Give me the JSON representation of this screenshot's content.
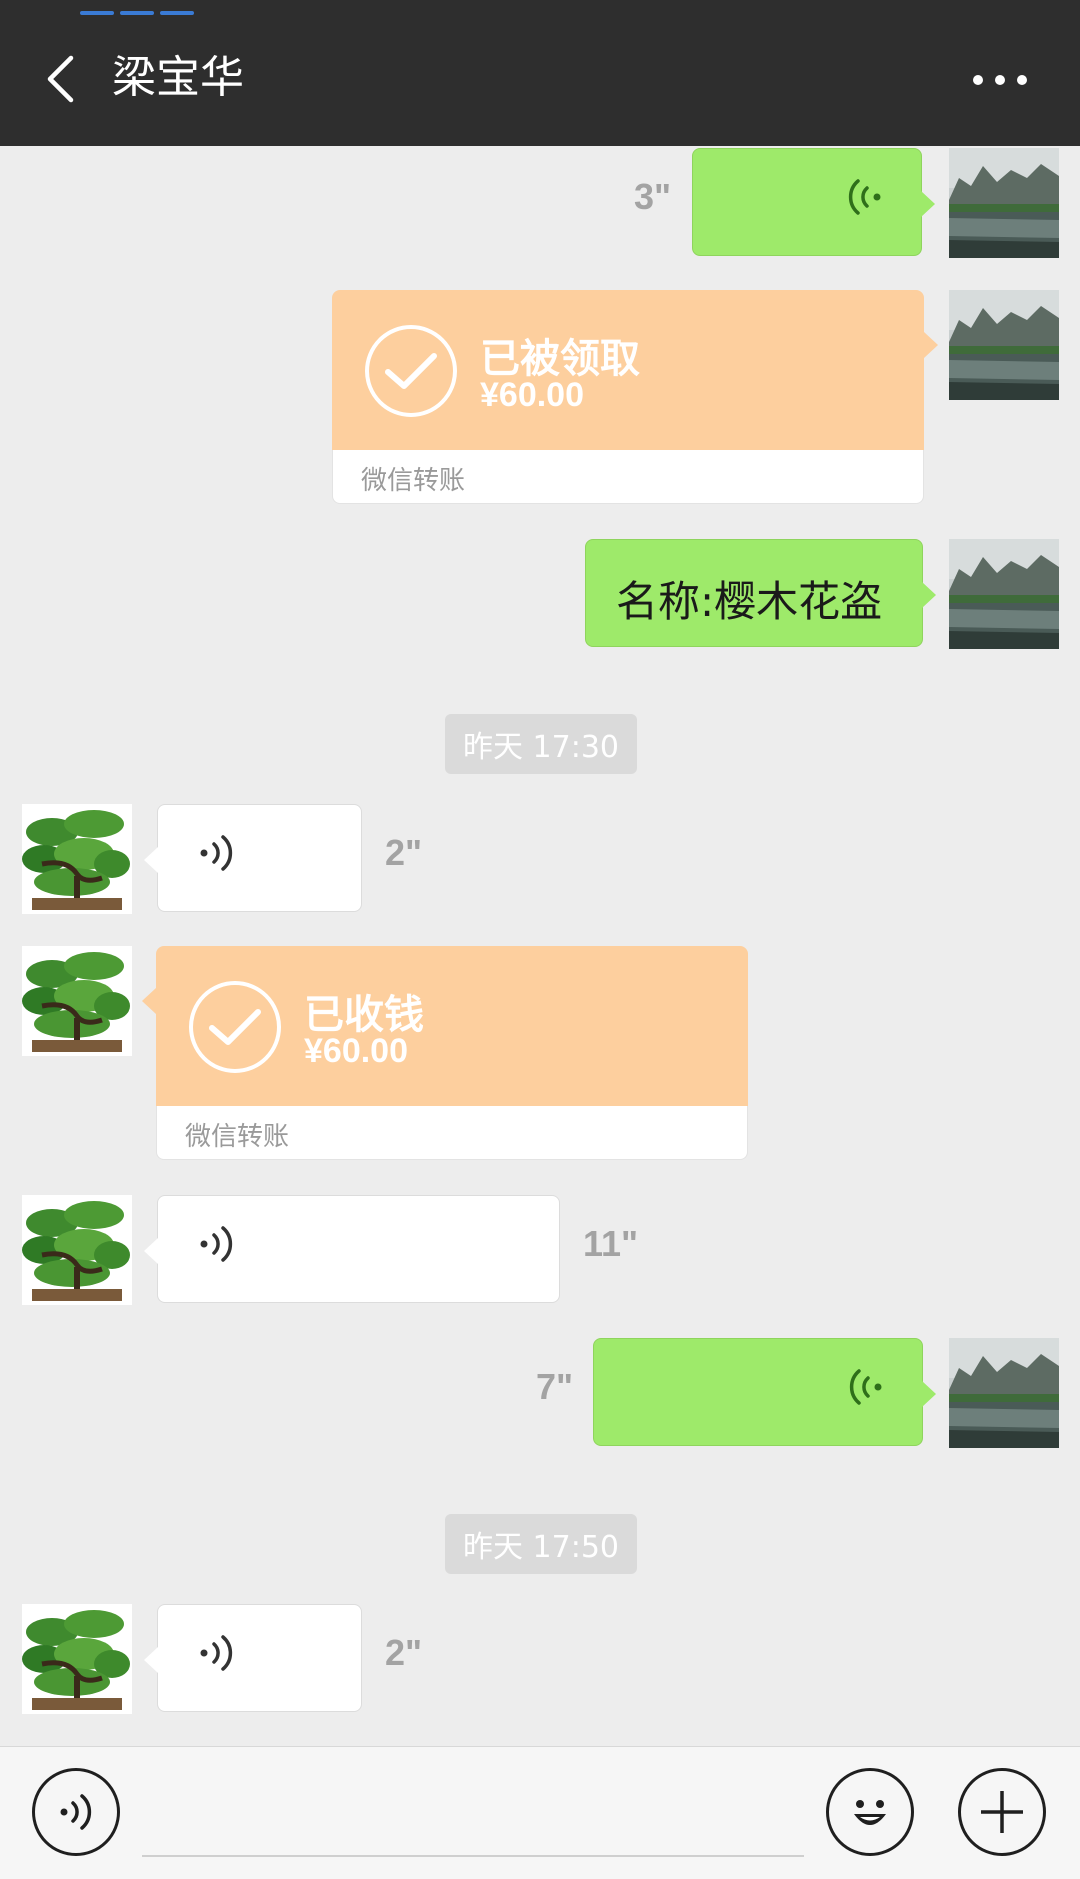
{
  "header": {
    "title": "梁宝华",
    "back_icon": "chevron-left-icon",
    "more_icon": "more-dots-icon"
  },
  "colors": {
    "topbar": "#2e2e2e",
    "self_bubble": "#9eea6a",
    "other_bubble": "#ffffff",
    "transfer": "#fdcf9e",
    "background": "#ededed"
  },
  "messages": [
    {
      "type": "voice",
      "side": "right",
      "duration": "3\""
    },
    {
      "type": "transfer",
      "side": "right",
      "status": "已被领取",
      "amount": "¥60.00",
      "label": "微信转账"
    },
    {
      "type": "text",
      "side": "right",
      "text": "名称:樱木花盗"
    },
    {
      "type": "timestamp",
      "text": "昨天 17:30"
    },
    {
      "type": "voice",
      "side": "left",
      "duration": "2\""
    },
    {
      "type": "transfer",
      "side": "left",
      "status": "已收钱",
      "amount": "¥60.00",
      "label": "微信转账"
    },
    {
      "type": "voice",
      "side": "left",
      "duration": "11\""
    },
    {
      "type": "voice",
      "side": "right",
      "duration": "7\""
    },
    {
      "type": "timestamp",
      "text": "昨天 17:50"
    },
    {
      "type": "voice",
      "side": "left",
      "duration": "2\""
    }
  ],
  "bottombar": {
    "voice_icon": "voice-input-icon",
    "emoji_icon": "emoji-icon",
    "plus_icon": "plus-icon",
    "input_value": ""
  }
}
